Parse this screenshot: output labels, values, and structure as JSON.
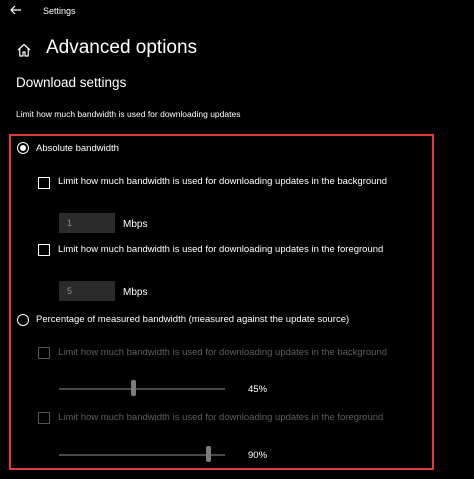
{
  "window": {
    "title": "Settings"
  },
  "header": {
    "title": "Advanced options"
  },
  "section": {
    "title": "Download settings",
    "description": "Limit how much bandwidth is used for downloading updates"
  },
  "absolute": {
    "label": "Absolute bandwidth",
    "selected": true,
    "background": {
      "label": "Limit how much bandwidth is used for downloading updates in the background",
      "checked": false,
      "value": "1",
      "unit": "Mbps"
    },
    "foreground": {
      "label": "Limit how much bandwidth is used for downloading updates in the foreground",
      "checked": false,
      "value": "5",
      "unit": "Mbps"
    }
  },
  "percentage": {
    "label": "Percentage of measured bandwidth (measured against the update source)",
    "selected": false,
    "background": {
      "label": "Limit how much bandwidth is used for downloading updates in the background",
      "checked": false,
      "value_label": "45%",
      "level": 0.45
    },
    "foreground": {
      "label": "Limit how much bandwidth is used for downloading updates in the foreground",
      "checked": false,
      "value_label": "90%",
      "level": 0.9
    }
  },
  "colors": {
    "highlight": "#e03a3a",
    "background": "#000000",
    "input": "#2b2b2b",
    "disabled_text": "#5e5e5e"
  },
  "icons": {
    "back": "back-arrow-icon",
    "home": "home-icon"
  }
}
